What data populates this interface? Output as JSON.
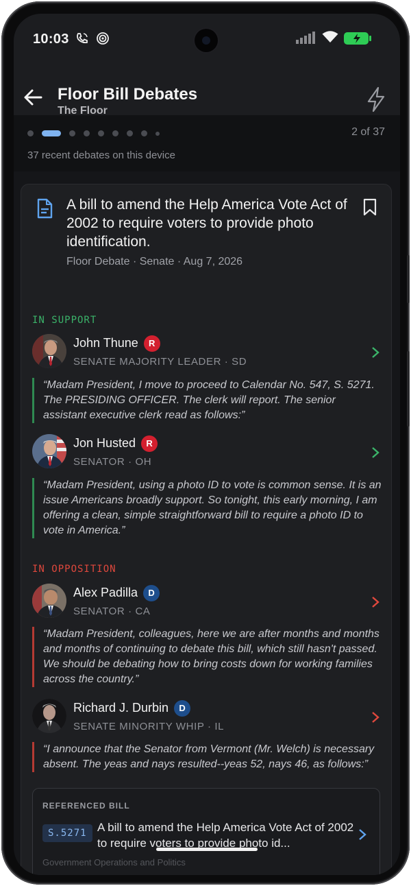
{
  "status_bar": {
    "time": "10:03"
  },
  "app_bar": {
    "title": "Floor Bill Debates",
    "subtitle": "The Floor"
  },
  "pager": {
    "count_text": "2 of 37",
    "note": "37 recent debates on this device",
    "total_dots": 9,
    "active_index": 1
  },
  "debate": {
    "title": "A bill to amend the Help America Vote Act of 2002 to require voters to provide photo identification.",
    "meta": "Floor Debate · Senate · Aug 7, 2026"
  },
  "support": {
    "label": "IN SUPPORT",
    "speakers": [
      {
        "name": "John Thune",
        "party": "R",
        "role": "SENATE MAJORITY LEADER · SD",
        "quote": "“Madam President, I move to proceed to Calendar No. 547, S. 5271. The PRESIDING OFFICER. The clerk will report. The senior assistant executive clerk read as follows:”"
      },
      {
        "name": "Jon Husted",
        "party": "R",
        "role": "SENATOR · OH",
        "quote": "“Madam President, using a photo ID to vote is common sense. It is an issue Americans broadly support. So tonight, this early morning, I am offering a clean, simple straightforward bill to require a photo ID to vote in America.”"
      }
    ]
  },
  "opposition": {
    "label": "IN OPPOSITION",
    "speakers": [
      {
        "name": "Alex Padilla",
        "party": "D",
        "role": "SENATOR · CA",
        "quote": "“Madam President, colleagues, here we are after months and months and months of continuing to debate this bill, which still hasn't passed. We should be debating how to bring costs down for working families across the country.”"
      },
      {
        "name": "Richard J. Durbin",
        "party": "D",
        "role": "SENATE MINORITY WHIP · IL",
        "quote": "“I announce that the Senator from Vermont (Mr. Welch) is necessary absent. The yeas and nays resulted--yeas 52, nays 46, as follows:”"
      }
    ]
  },
  "referenced_bill": {
    "label": "REFERENCED BILL",
    "code": "S.5271",
    "title": "A bill to amend the Help America Vote Act of 2002 to require voters to provide photo id...",
    "category": "Government Operations and Politics"
  },
  "colors": {
    "support": "#3bb46a",
    "opposition": "#e0483d",
    "accent": "#7fb3f0",
    "republican": "#d3202f",
    "democrat": "#1e4e8c"
  }
}
